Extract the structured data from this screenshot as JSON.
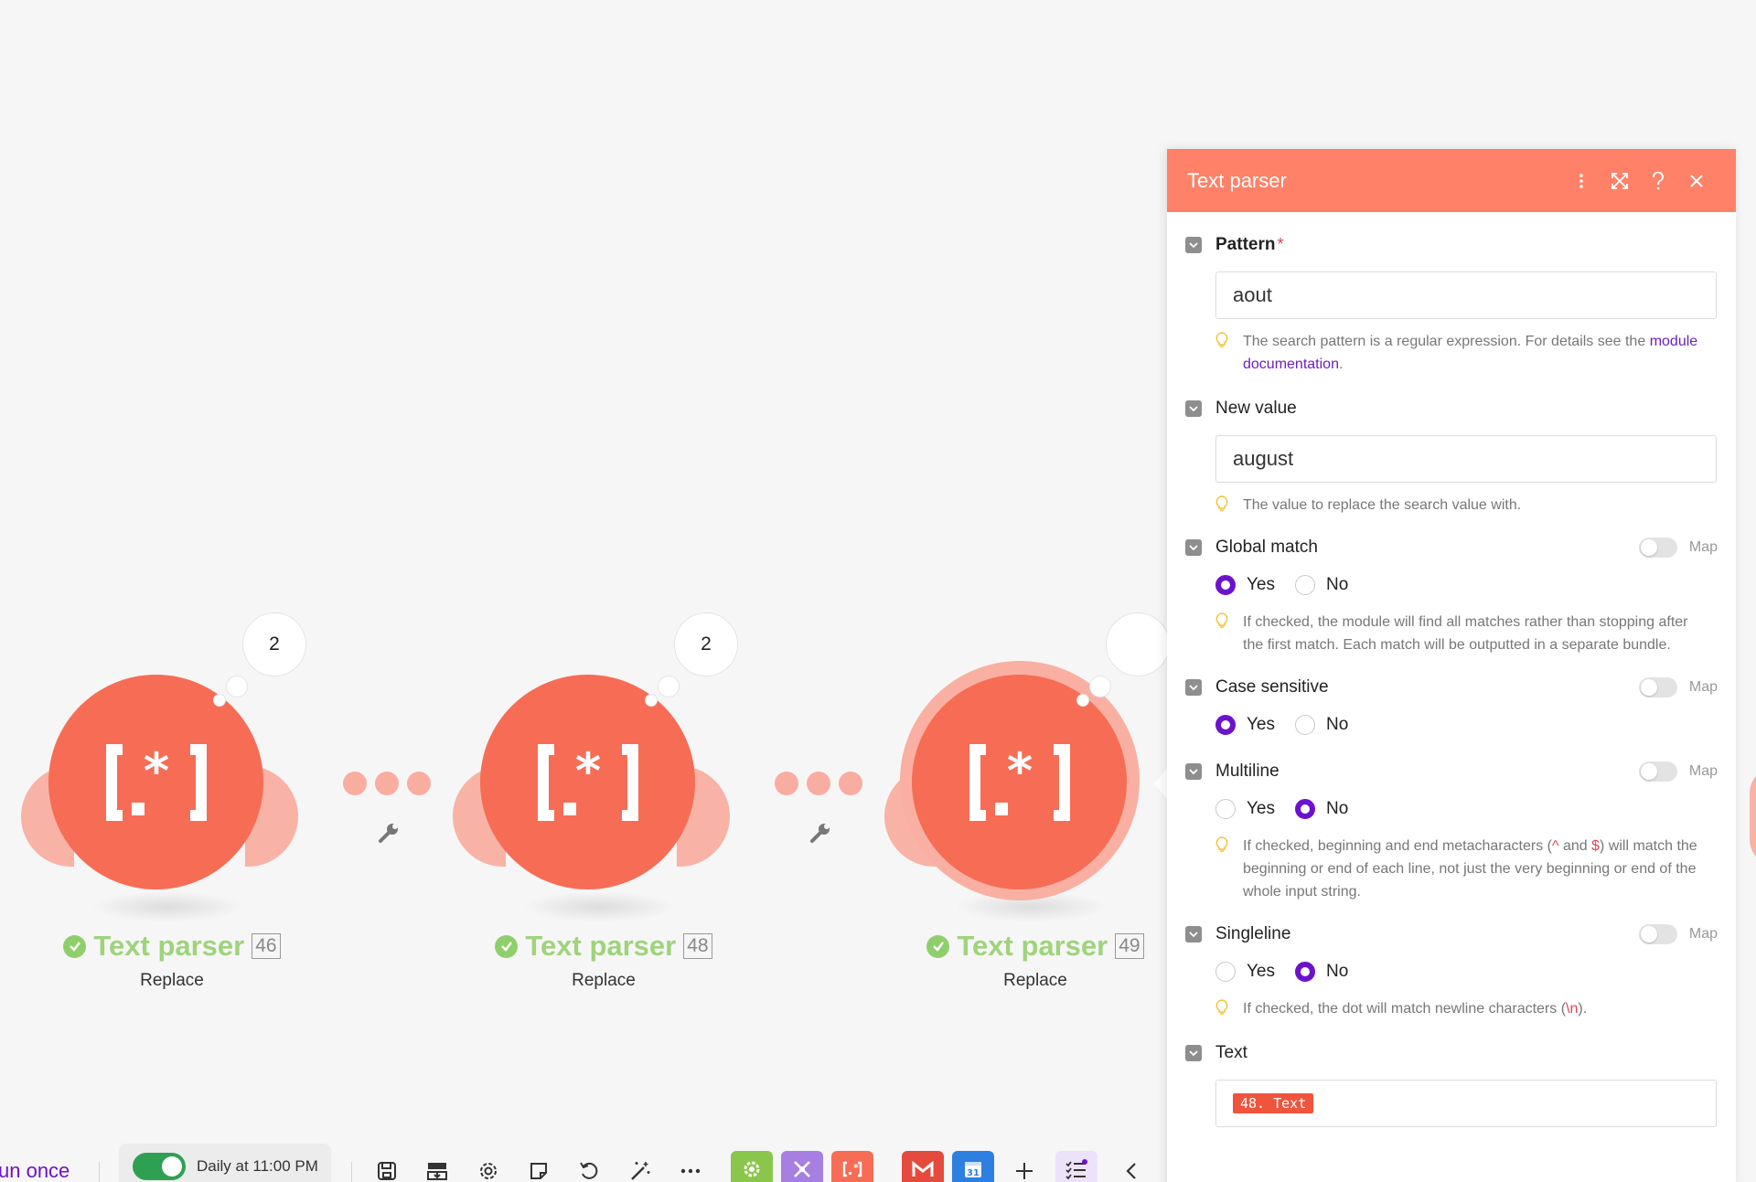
{
  "scenario": {
    "modules": [
      {
        "title": "Text parser",
        "id": "46",
        "subtitle": "Replace",
        "bundles": "2"
      },
      {
        "title": "Text parser",
        "id": "48",
        "subtitle": "Replace",
        "bundles": "2"
      },
      {
        "title": "Text parser",
        "id": "49",
        "subtitle": "Replace",
        "bundles": ""
      }
    ],
    "module_icon_glyph": "[.*]"
  },
  "panel": {
    "title": "Text parser",
    "map_label": "Map",
    "yes_label": "Yes",
    "no_label": "No",
    "pattern": {
      "label": "Pattern",
      "required_mark": "*",
      "value": "aout",
      "hint_prefix": "The search pattern is a regular expression. For details see the",
      "hint_link": "module documentation",
      "hint_suffix": "."
    },
    "new_value": {
      "label": "New value",
      "value": "august",
      "hint": "The value to replace the search value with."
    },
    "global_match": {
      "label": "Global match",
      "selected": "Yes",
      "hint": "If checked, the module will find all matches rather than stopping after the first match. Each match will be outputted in a separate bundle."
    },
    "case_sensitive": {
      "label": "Case sensitive",
      "selected": "Yes"
    },
    "multiline": {
      "label": "Multiline",
      "selected": "No",
      "hint_part1": "If checked, beginning and end metacharacters (",
      "hint_code1": "^",
      "hint_part2": " and ",
      "hint_code2": "$",
      "hint_part3": ") will match the beginning or end of each line, not just the very beginning or end of the whole input string."
    },
    "singleline": {
      "label": "Singleline",
      "selected": "No",
      "hint_part1": "If checked, the dot will match newline characters (",
      "hint_code": "\\n",
      "hint_part2": ")."
    },
    "text": {
      "label": "Text",
      "pill": "48. Text"
    }
  },
  "toolbar": {
    "run_once_label": "un once",
    "schedule_label": "Daily at 11:00 PM",
    "schedule_enabled": true,
    "icons": [
      "save-icon",
      "import-export-icon",
      "gear-icon",
      "notes-icon",
      "undo-icon",
      "magic-wand-icon",
      "more-icon",
      "tools-app-icon",
      "flow-control-app-icon",
      "text-parser-app-icon",
      "gmail-app-icon",
      "google-calendar-app-icon",
      "plus-icon",
      "checklist-icon",
      "chevron-left-icon"
    ]
  },
  "colors": {
    "module": "#f76c55",
    "module_light": "#f8b3a6",
    "panel_header": "#fe8168",
    "accent_purple": "#6c12cc",
    "success_green": "#8fcf6b",
    "schedule_green": "#2fa052"
  }
}
